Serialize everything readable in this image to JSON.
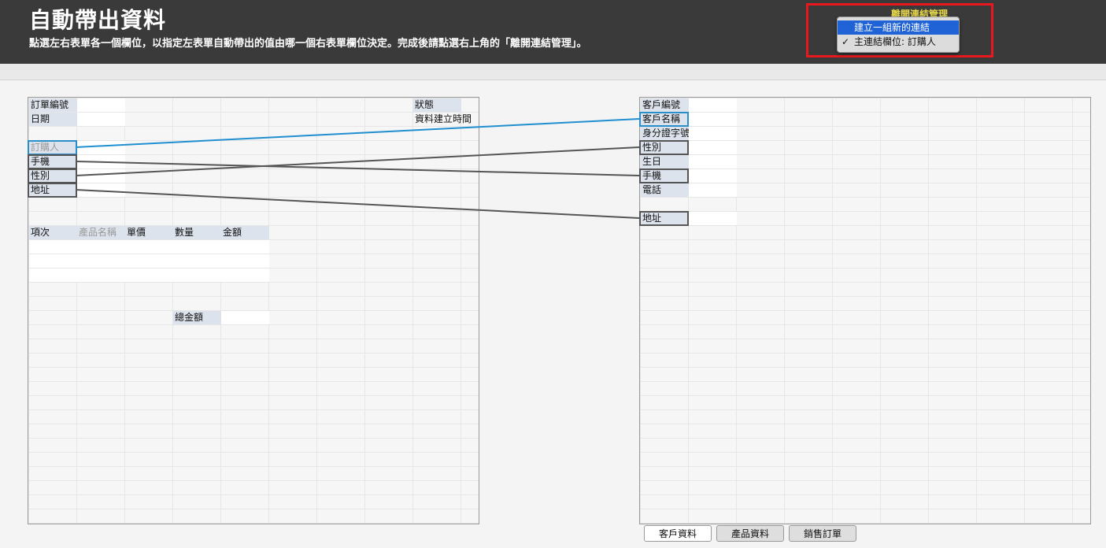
{
  "header": {
    "title": "自動帶出資料",
    "subtitle": "點選左右表單各一個欄位，以指定左表單自動帶出的值由哪一個右表單欄位決定。完成後請點選右上角的「離開連結管理」。",
    "leave_link": "離開連結管理"
  },
  "popup_menu": {
    "items": [
      {
        "label": "建立一組新的連結",
        "selected": true
      },
      {
        "label": "主連結欄位: 訂購人",
        "checked": true,
        "check": "✓"
      }
    ]
  },
  "left_form": {
    "order_no": "訂單編號",
    "date": "日期",
    "status": "狀態",
    "created_time": "資料建立時間",
    "buyer": "訂購人",
    "mobile": "手機",
    "gender": "性別",
    "address": "地址",
    "item_columns": [
      "項次",
      "產品名稱",
      "單價",
      "數量",
      "金額"
    ],
    "total_label": "總金額"
  },
  "right_form": {
    "customer_no": "客戶編號",
    "customer_name": "客戶名稱",
    "id_number": "身分證字號",
    "gender": "性別",
    "birthday": "生日",
    "mobile": "手機",
    "phone": "電話",
    "address": "地址"
  },
  "links": [
    {
      "from": "訂購人",
      "to": "客戶名稱",
      "color": "#1f8fcf"
    },
    {
      "from": "手機",
      "to": "手機",
      "color": "#555555"
    },
    {
      "from": "性別",
      "to": "性別",
      "color": "#555555"
    },
    {
      "from": "地址",
      "to": "地址",
      "color": "#555555"
    }
  ],
  "tabs": [
    {
      "label": "客戶資料",
      "active": true
    },
    {
      "label": "產品資料",
      "active": false
    },
    {
      "label": "銷售訂單",
      "active": false
    }
  ],
  "colors": {
    "header_bg": "#3a3a3a",
    "highlight_border": "#e8181e",
    "leave_link": "#e8d84a",
    "menu_selected": "#1f63d6",
    "label_bg": "#dde3ec"
  }
}
